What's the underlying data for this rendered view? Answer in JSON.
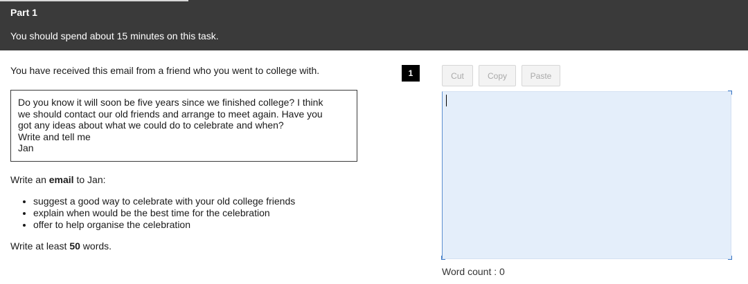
{
  "header": {
    "part_title": "Part 1",
    "time_note": "You should spend about 15 minutes on this task."
  },
  "task": {
    "intro": "You have received this email from a friend who you went to college with.",
    "email_lines": [
      "Do you know it will soon be five years since we finished college? I think",
      "we should contact our old friends and arrange to meet again. Have you",
      "got any ideas about what we could do to celebrate and when?",
      "Write and tell me",
      "Jan"
    ],
    "instruction": {
      "pre": "Write an ",
      "bold": "email",
      "post": " to Jan:"
    },
    "bullets": [
      "suggest a good way to celebrate with your old college friends",
      "explain when would be the best time for the celebration",
      "offer to help organise the celebration"
    ],
    "word_requirement": {
      "pre": "Write at least ",
      "bold": "50",
      "post": " words."
    }
  },
  "question_number": "1",
  "toolbar": {
    "cut_label": "Cut",
    "copy_label": "Copy",
    "paste_label": "Paste"
  },
  "answer": {
    "value": ""
  },
  "word_count": {
    "label": "Word count : ",
    "value": "0"
  },
  "colors": {
    "header_bg": "#3a3a3a",
    "answer_bg": "#e4eefa",
    "answer_border": "#5c8fcf"
  }
}
